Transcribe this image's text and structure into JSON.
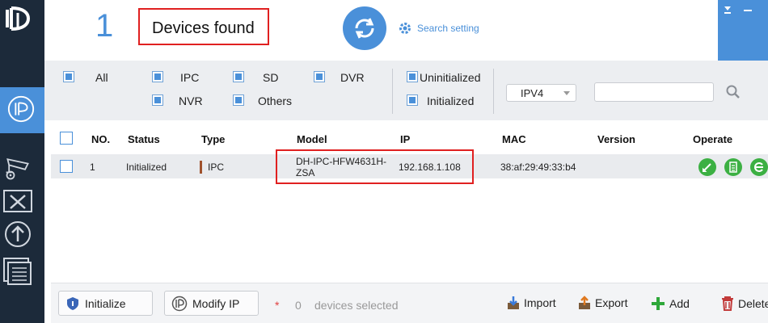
{
  "app": {
    "logo_text": "ID"
  },
  "header": {
    "device_count": "1",
    "found_label": "Devices found",
    "search_setting_label": "Search setting"
  },
  "filters": {
    "all": "All",
    "ipc": "IPC",
    "sd": "SD",
    "dvr": "DVR",
    "nvr": "NVR",
    "others": "Others",
    "uninitialized": "Uninitialized",
    "initialized": "Initialized",
    "ip_version": "IPV4",
    "search_placeholder": ""
  },
  "table": {
    "columns": {
      "no": "NO.",
      "status": "Status",
      "type": "Type",
      "model": "Model",
      "ip": "IP",
      "mac": "MAC",
      "version": "Version",
      "operate": "Operate"
    },
    "rows": [
      {
        "no": "1",
        "status": "Initialized",
        "type": "IPC",
        "model_line1": "DH-IPC-HFW4631H-",
        "model_line2": "ZSA",
        "ip": "192.168.1.108",
        "mac": "38:af:29:49:33:b4",
        "version": ""
      }
    ]
  },
  "footer": {
    "initialize_label": "Initialize",
    "modify_ip_label": "Modify IP",
    "star": "*",
    "selected_count": "0",
    "selected_text": "devices selected",
    "import_label": "Import",
    "export_label": "Export",
    "add_label": "Add",
    "delete_label": "Delete"
  },
  "colors": {
    "accent": "#4a90d9",
    "sidebar": "#1c2a3a",
    "highlight_red": "#e02020",
    "op_green": "#3cb043"
  },
  "icons": {
    "sidebar": [
      "ip-config-icon",
      "camera-settings-icon",
      "tools-icon",
      "upgrade-icon",
      "document-icon"
    ],
    "operate": [
      "edit-icon",
      "details-icon",
      "web-browser-icon"
    ]
  }
}
